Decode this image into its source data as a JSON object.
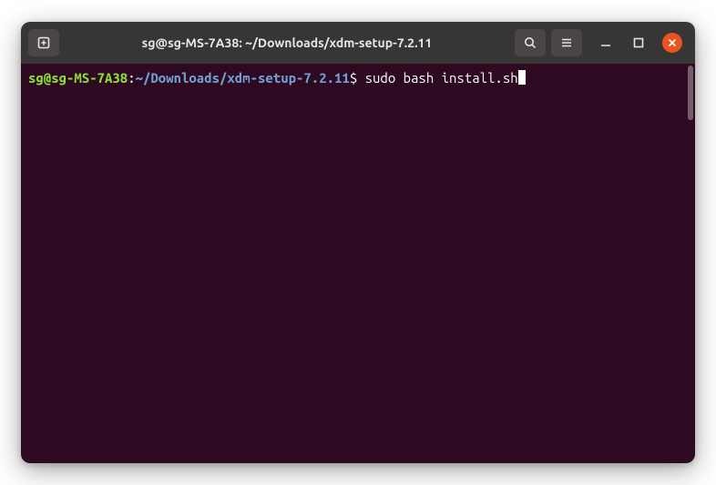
{
  "window": {
    "title": "sg@sg-MS-7A38: ~/Downloads/xdm-setup-7.2.11"
  },
  "terminal": {
    "prompt": {
      "user_host": "sg@sg-MS-7A38",
      "colon": ":",
      "path": "~/Downloads/xdm-setup-7.2.11",
      "dollar": "$ "
    },
    "command": "sudo bash install.sh"
  }
}
